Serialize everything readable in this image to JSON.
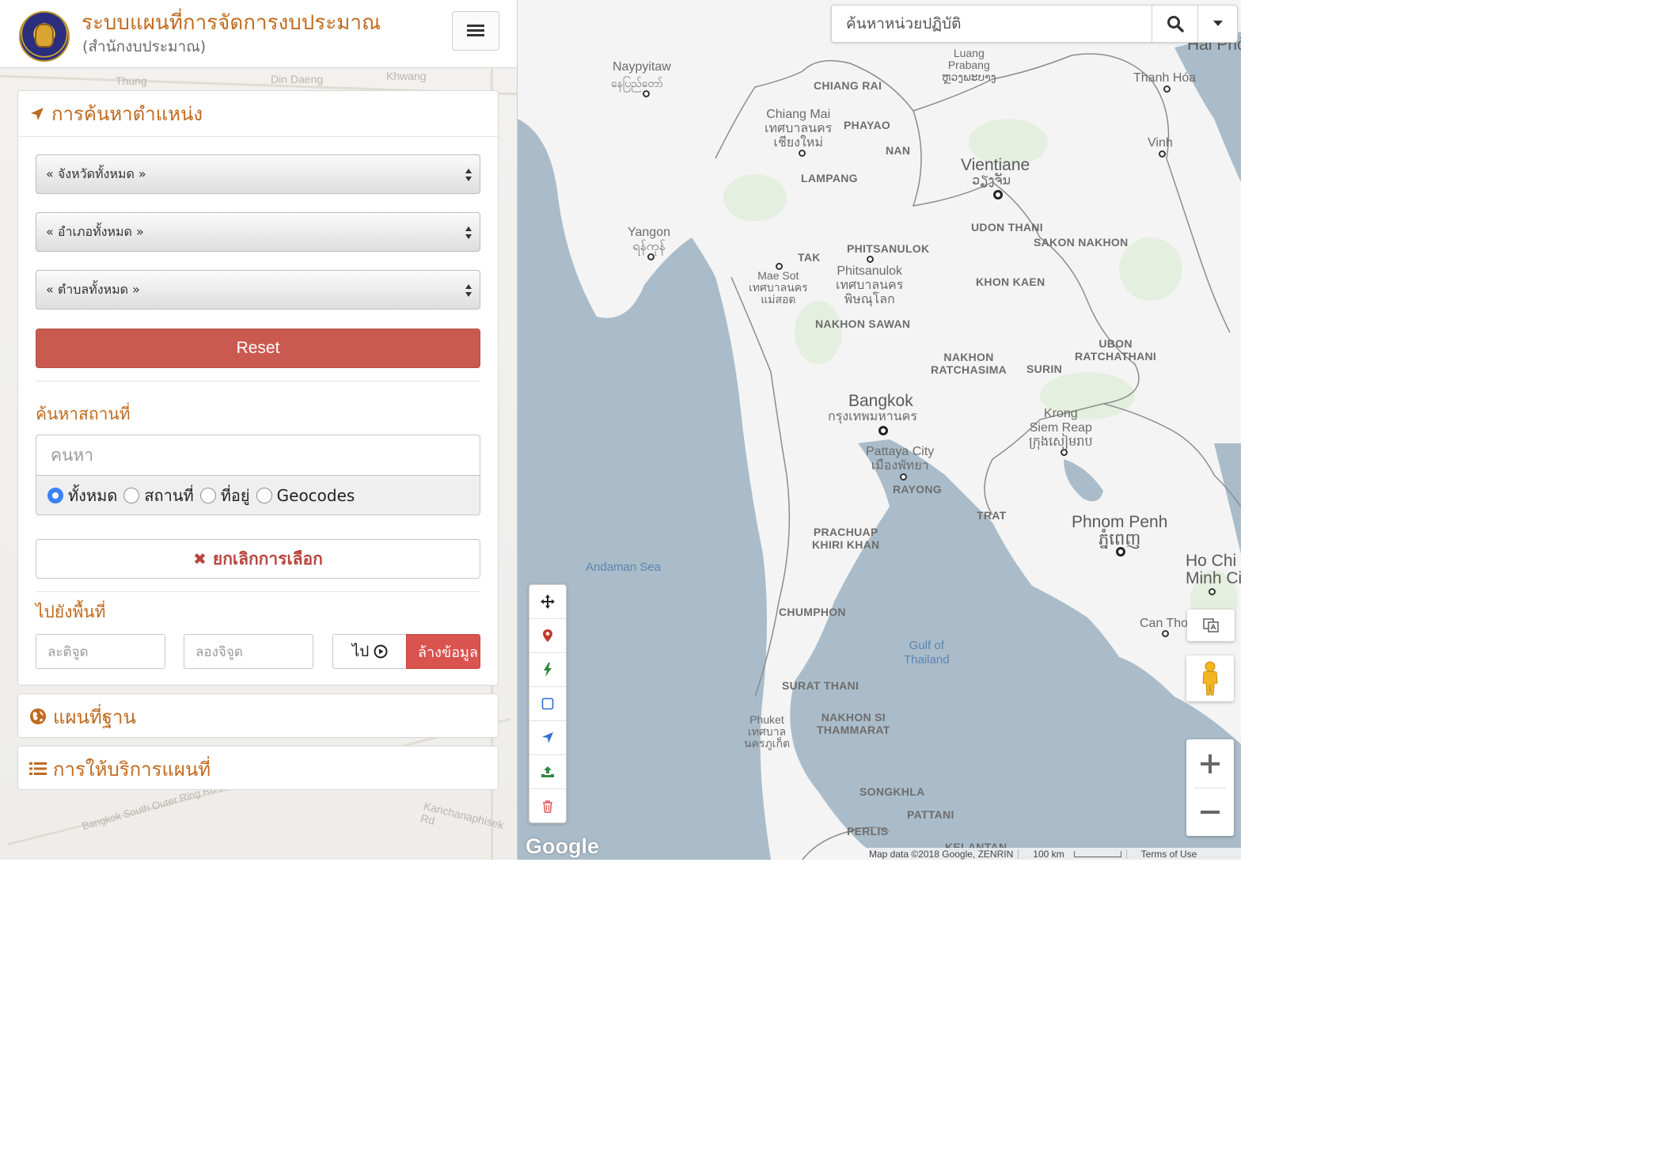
{
  "header": {
    "title": "ระบบแผนที่การจัดการงบประมาณ",
    "subtitle": "(สำนักงบประมาณ)"
  },
  "location_panel": {
    "title": "การค้นหาตำแหน่ง",
    "province_select": "« จังหวัดทั้งหมด »",
    "district_select": "« อำเภอทั้งหมด »",
    "subdistrict_select": "« ตำบลทั้งหมด »",
    "reset_label": "Reset",
    "place_search_label": "ค้นหาสถานที่",
    "search_placeholder": "คนหา",
    "radio_options": [
      {
        "label": "ทั้งหมด",
        "checked": true
      },
      {
        "label": "สถานที่",
        "checked": false
      },
      {
        "label": "ที่อยู่",
        "checked": false
      },
      {
        "label": "Geocodes",
        "checked": false
      }
    ],
    "clear_selection_label": "ยกเลิกการเลือก",
    "goto_area_label": "ไปยังพื้นที่",
    "latitude_placeholder": "ละติจูด",
    "longitude_placeholder": "ลองจิจูด",
    "go_label": "ไป",
    "clear_data_label": "ล้างข้อมูล"
  },
  "basemap_panel": {
    "title": "แผนที่ฐาน"
  },
  "service_panel": {
    "title": "การให้บริการแผนที่"
  },
  "left_background_labels": [
    "Thung",
    "Din Daeng",
    "Khwang",
    "Kanchanaphisek Rd",
    "Bangkok South Outer Ring Rd (Toll)"
  ],
  "map": {
    "search_placeholder": "ค้นหาหน่วยปฏิบัติ",
    "labels": {
      "naypyitaw": "Naypyitaw",
      "naypyitaw_local": "နေပြည်တော်",
      "luang_prabang": "Luang\nPrabang\nຫຼວງພະບາງ",
      "hai_phong": "Hai Phòn",
      "thanh_hoa": "Thanh Hóa",
      "vinh": "Vinh",
      "chiang_rai": "CHIANG RAI",
      "chiang_mai": "Chiang Mai\nเทศบาลนคร\nเชียงใหม่",
      "phayao": "PHAYAO",
      "nan": "NAN",
      "lampang": "LAMPANG",
      "vientiane": "Vientiane",
      "vientiane_local": "ວຽງຈັນ",
      "udon_thani": "UDON THANI",
      "sakon_nakhon": "SAKON NAKHON",
      "yangon": "Yangon\nရန်ကုန်",
      "phitsanulok_prov": "PHITSANULOK",
      "tak": "TAK",
      "mae_sot": "Mae Sot\nเทศบาลนคร\nแม่สอด",
      "phitsanulok_city": "Phitsanulok\nเทศบาลนคร\nพิษณุโลก",
      "khon_kaen": "KHON KAEN",
      "nakhon_sawan": "NAKHON SAWAN",
      "ubon": "UBON\nRATCHATHANI",
      "nakhon_ratchasima": "NAKHON\nRATCHASIMA",
      "surin": "SURIN",
      "bangkok": "Bangkok",
      "bangkok_local": "กรุงเทพมหานคร",
      "krong_siem_reap": "Krong\nSiem Reap\nក្រុងសៀមរាប",
      "pattaya": "Pattaya City\nเมืองพัทยา",
      "rayong": "RAYONG",
      "trat": "TRAT",
      "phnom_penh": "Phnom Penh\nភ្នំពេញ",
      "prachuap": "PRACHUAP\nKHIRI KHAN",
      "andaman_sea": "Andaman Sea",
      "ho_chi_minh": "Ho Chi\nMinh Cit",
      "chumphon": "CHUMPHON",
      "gulf_of_thailand": "Gulf of\nThailand",
      "can_tho": "Can Tho",
      "surat_thani": "SURAT THANI",
      "phuket": "Phuket\nเทศบาล\nนครภูเก็ต",
      "nakhon_si_thammarat": "NAKHON SI\nTHAMMARAT",
      "songkhla": "SONGKHLA",
      "pattani": "PATTANI",
      "perlis": "PERLIS",
      "kelantan": "KELANTAN"
    },
    "google_logo": "Google",
    "attribution": "Map data ©2018 Google, ZENRIN",
    "scale": "100 km",
    "terms": "Terms of Use"
  },
  "colors": {
    "accent_orange": "#c16a1e",
    "reset_red": "#ca5a50",
    "clear_red": "#b8453d",
    "water": "#aabcc9",
    "land": "#f4f4f4"
  }
}
